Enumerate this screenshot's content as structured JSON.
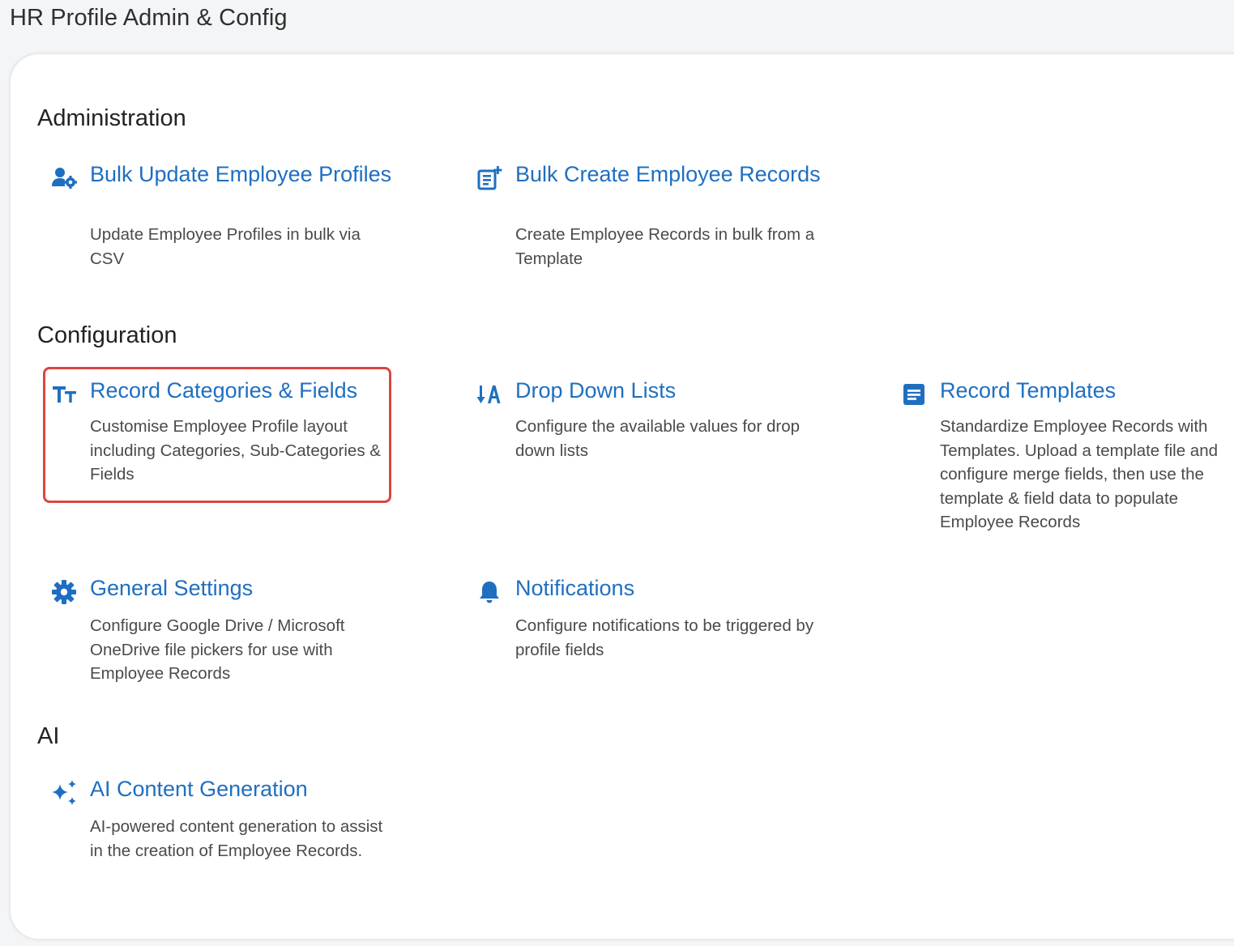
{
  "page": {
    "title": "HR Profile Admin & Config"
  },
  "colors": {
    "link": "#1f6fc0",
    "highlight_border": "#d9473f"
  },
  "sections": {
    "administration": {
      "heading": "Administration",
      "items": [
        {
          "icon": "user-gear-icon",
          "title": "Bulk Update Employee Profiles",
          "description": "Update Employee Profiles in bulk via CSV"
        },
        {
          "icon": "add-record-icon",
          "title": "Bulk Create Employee Records",
          "description": "Create Employee Records in bulk from a Template"
        }
      ]
    },
    "configuration": {
      "heading": "Configuration",
      "items": [
        {
          "icon": "text-size-icon",
          "title": "Record Categories & Fields",
          "description": "Customise Employee Profile layout including Categories, Sub-Categories & Fields",
          "highlighted": true
        },
        {
          "icon": "sort-alpha-icon",
          "title": "Drop Down Lists",
          "description": "Configure the available values for drop down lists"
        },
        {
          "icon": "document-icon",
          "title": "Record Templates",
          "description": "Standardize Employee Records with Templates. Upload a template file and configure merge fields, then use the template & field data to populate Employee Records"
        },
        {
          "icon": "gear-icon",
          "title": "General Settings",
          "description": "Configure Google Drive / Microsoft OneDrive file pickers for use with Employee Records"
        },
        {
          "icon": "bell-icon",
          "title": "Notifications",
          "description": "Configure notifications to be triggered by profile fields"
        }
      ]
    },
    "ai": {
      "heading": "AI",
      "items": [
        {
          "icon": "sparkles-icon",
          "title": "AI Content Generation",
          "description": "AI-powered content generation to assist in the creation of Employee Records."
        }
      ]
    }
  }
}
